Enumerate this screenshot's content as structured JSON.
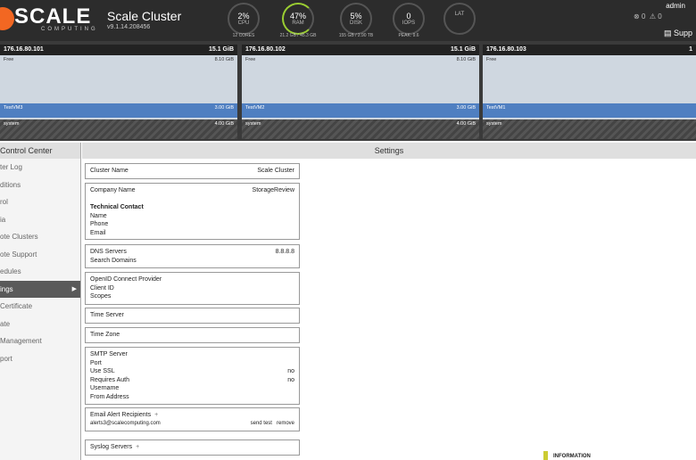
{
  "app": {
    "brand": "SCALE",
    "brand_sub": "COMPUTING",
    "cluster_name": "Scale Cluster",
    "version": "v9.1.14.208456"
  },
  "gauges": [
    {
      "value": "2%",
      "label": "CPU",
      "sub": "12 CORES"
    },
    {
      "value": "47%",
      "label": "RAM",
      "sub": "21.2 GB / 45.3 GB"
    },
    {
      "value": "5%",
      "label": "DISK",
      "sub": "155 GB / 2.90 TB"
    },
    {
      "value": "0",
      "label": "IOPS",
      "sub": "PEAK: 9.6"
    },
    {
      "value": "",
      "label": "LAT",
      "sub": ""
    }
  ],
  "user": "admin",
  "alerts": {
    "errors": "0",
    "warnings": "0"
  },
  "support_label": "Supp",
  "nodes": [
    {
      "ip": "176.16.80.101",
      "total": "15.1 GiB",
      "free_label": "Free",
      "free": "8.10 GiB",
      "vm": "TestVM3",
      "vm_mem": "3.00 GiB",
      "sys": "system",
      "sys_mem": "4.00 GiB"
    },
    {
      "ip": "176.16.80.102",
      "total": "15.1 GiB",
      "free_label": "Free",
      "free": "8.10 GiB",
      "vm": "TestVM2",
      "vm_mem": "3.00 GiB",
      "sys": "system",
      "sys_mem": "4.00 GiB"
    },
    {
      "ip": "176.16.80.103",
      "total": "1",
      "free_label": "Free",
      "free": "",
      "vm": "TestVM1",
      "vm_mem": "",
      "sys": "system",
      "sys_mem": ""
    }
  ],
  "sidebar": {
    "title": "Control Center",
    "items": [
      "ter Log",
      "ditions",
      "rol",
      "ia",
      "ote Clusters",
      "ote Support",
      "edules",
      "ings",
      "Certificate",
      "ate",
      "Management",
      "port"
    ]
  },
  "settings": {
    "title": "Settings",
    "cluster_name_label": "Cluster Name",
    "cluster_name_value": "Scale Cluster",
    "company_name_label": "Company Name",
    "company_name_value": "StorageReview",
    "tech_contact": "Technical Contact",
    "name": "Name",
    "phone": "Phone",
    "email": "Email",
    "dns_label": "DNS Servers",
    "dns_value": "8.8.8.8",
    "search_domains": "Search Domains",
    "oidc": "OpenID Connect Provider",
    "client_id": "Client ID",
    "scopes": "Scopes",
    "time_server": "Time Server",
    "time_zone": "Time Zone",
    "smtp": "SMTP Server",
    "port": "Port",
    "use_ssl": "Use SSL",
    "use_ssl_val": "no",
    "requires_auth": "Requires Auth",
    "requires_auth_val": "no",
    "username": "Username",
    "from_address": "From Address",
    "email_recipients": "Email Alert Recipients",
    "plus": "+",
    "recipient": "alerts3@scalecomputing.com",
    "send_test": "send test",
    "remove": "remove",
    "syslog": "Syslog Servers"
  },
  "info_label": "INFORMATION"
}
